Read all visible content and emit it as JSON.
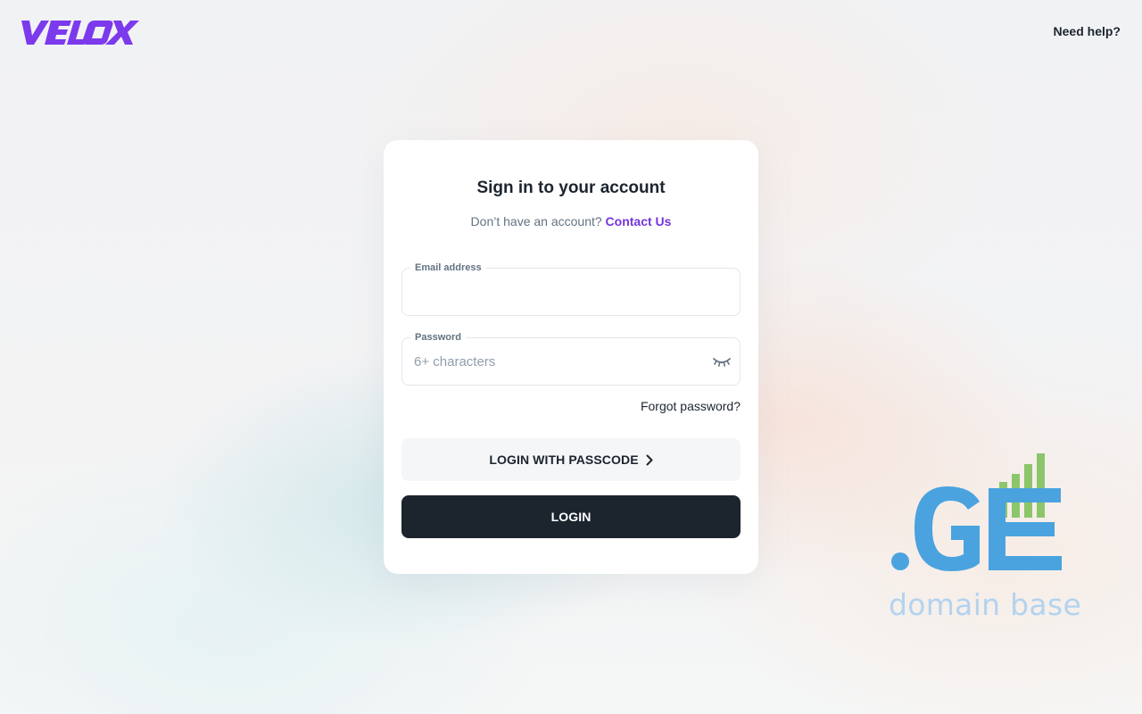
{
  "header": {
    "logo_text": "VELOX",
    "help_link": "Need help?"
  },
  "card": {
    "title": "Sign in to your account",
    "subtitle_text": "Don’t have an account?",
    "contact_link": "Contact Us",
    "email": {
      "label": "Email address",
      "value": "",
      "placeholder": ""
    },
    "password": {
      "label": "Password",
      "value": "",
      "placeholder": "6+ characters"
    },
    "forgot_link": "Forgot password?",
    "passcode_button": "LOGIN WITH PASSCODE",
    "login_button": "LOGIN"
  },
  "watermark": {
    "logo_text": ".GE",
    "tagline": "domain base"
  },
  "colors": {
    "brand_purple": "#7635dc",
    "dark_button": "#1c252e",
    "watermark_blue": "#4aa3df",
    "watermark_green": "#8cc66a"
  },
  "icons": {
    "password_toggle": "eye-closed-icon",
    "passcode_arrow": "chevron-right-icon"
  }
}
